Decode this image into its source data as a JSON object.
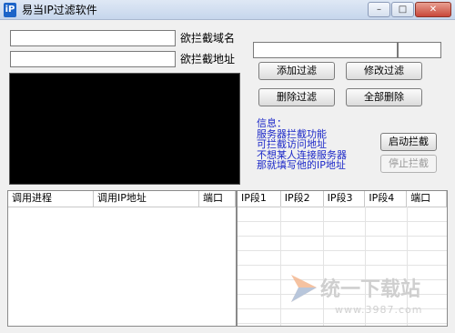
{
  "window": {
    "title": "易当IP过滤软件",
    "app_icon_glyph": "iP",
    "minimize_glyph": "–",
    "maximize_glyph": "□",
    "close_glyph": "✕"
  },
  "domain_input": {
    "value": "",
    "label": "欲拦截域名"
  },
  "address_input": {
    "value": "",
    "label": "欲拦截地址"
  },
  "filter_input_left": {
    "value": ""
  },
  "filter_input_right": {
    "value": ""
  },
  "buttons": {
    "add_filter": "添加过滤",
    "edit_filter": "修改过滤",
    "delete_filter": "删除过滤",
    "delete_all": "全部删除",
    "start_block": "启动拦截",
    "stop_block": "停止拦截"
  },
  "info": {
    "lines": [
      "信息：",
      "服务器拦截功能",
      "可拦截访问地址",
      "不想某人连接服务器",
      "那就填写他的IP地址"
    ]
  },
  "left_list": {
    "columns": [
      "调用进程",
      "调用IP地址",
      "端口"
    ]
  },
  "right_list": {
    "columns": [
      "IP段1",
      "IP段2",
      "IP段3",
      "IP段4",
      "端口"
    ]
  },
  "watermark": {
    "text": "统一下载站",
    "url": "www.3987.com"
  },
  "colors": {
    "info_text": "#1c28c8",
    "terminal_bg": "#000000"
  }
}
